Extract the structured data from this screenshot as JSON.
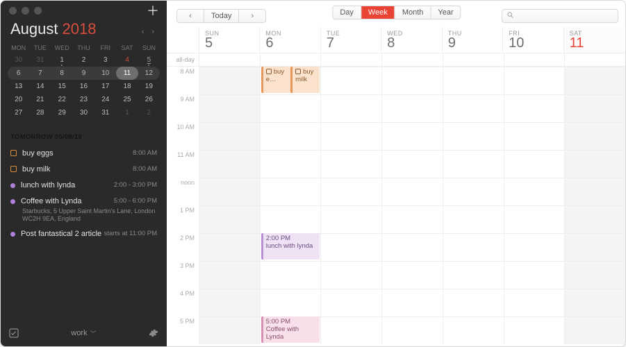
{
  "sidebar": {
    "month": "August",
    "year": "2018",
    "dows": [
      "MON",
      "TUE",
      "WED",
      "THU",
      "FRI",
      "SAT",
      "SUN"
    ],
    "weeks": [
      [
        {
          "n": "30",
          "dim": true
        },
        {
          "n": "31",
          "dim": true
        },
        {
          "n": "1",
          "dot": true
        },
        {
          "n": "2"
        },
        {
          "n": "3"
        },
        {
          "n": "4",
          "accent": true
        },
        {
          "n": "5",
          "ul": true,
          "dot": true
        }
      ],
      [
        {
          "n": "6"
        },
        {
          "n": "7"
        },
        {
          "n": "8"
        },
        {
          "n": "9"
        },
        {
          "n": "10"
        },
        {
          "n": "11",
          "today": true
        },
        {
          "n": "12"
        }
      ],
      [
        {
          "n": "13"
        },
        {
          "n": "14"
        },
        {
          "n": "15"
        },
        {
          "n": "16"
        },
        {
          "n": "17"
        },
        {
          "n": "18"
        },
        {
          "n": "19"
        }
      ],
      [
        {
          "n": "20"
        },
        {
          "n": "21"
        },
        {
          "n": "22"
        },
        {
          "n": "23"
        },
        {
          "n": "24"
        },
        {
          "n": "25"
        },
        {
          "n": "26"
        }
      ],
      [
        {
          "n": "27"
        },
        {
          "n": "28"
        },
        {
          "n": "29"
        },
        {
          "n": "30"
        },
        {
          "n": "31"
        },
        {
          "n": "1",
          "dim": true
        },
        {
          "n": "2",
          "dim": true
        }
      ]
    ],
    "list_header": "TOMORROW 05/08/18",
    "items": [
      {
        "type": "task",
        "label": "buy eggs",
        "time": "8:00 AM"
      },
      {
        "type": "task",
        "label": "buy milk",
        "time": "8:00 AM"
      },
      {
        "type": "event",
        "color": "pu",
        "label": "lunch with lynda",
        "time": "2:00 - 3:00 PM"
      },
      {
        "type": "event",
        "color": "pu",
        "label": "Coffee with Lynda",
        "time": "5:00 - 6:00 PM",
        "location": "Starbucks, 5 Upper Saint Martin's Lane, London WC2H 9EA, England"
      },
      {
        "type": "event",
        "color": "pu",
        "label": "Post fantastical 2 article",
        "time": "starts at 11:00 PM"
      }
    ],
    "footer_calendar": "work"
  },
  "toolbar": {
    "today": "Today",
    "views": {
      "day": "Day",
      "week": "Week",
      "month": "Month",
      "year": "Year"
    },
    "search_placeholder": ""
  },
  "week": {
    "allday_label": "all-day",
    "days": [
      {
        "dow": "SUN",
        "num": "5",
        "kind": "sun"
      },
      {
        "dow": "MON",
        "num": "6"
      },
      {
        "dow": "TUE",
        "num": "7"
      },
      {
        "dow": "WED",
        "num": "8"
      },
      {
        "dow": "THU",
        "num": "9"
      },
      {
        "dow": "FRI",
        "num": "10"
      },
      {
        "dow": "SAT",
        "num": "11",
        "kind": "sat",
        "today": true
      }
    ],
    "hours": [
      "8 AM",
      "9 AM",
      "10 AM",
      "11 AM",
      "noon",
      "1 PM",
      "2 PM",
      "3 PM",
      "4 PM",
      "5 PM"
    ],
    "events": {
      "mon_buy_eggs_label": "buy e…",
      "mon_buy_milk_label": "buy milk",
      "mon_lunch_time": "2:00 PM",
      "mon_lunch_label": "lunch with lynda",
      "mon_coffee_time": "5:00 PM",
      "mon_coffee_label": "Coffee with Lynda"
    }
  }
}
